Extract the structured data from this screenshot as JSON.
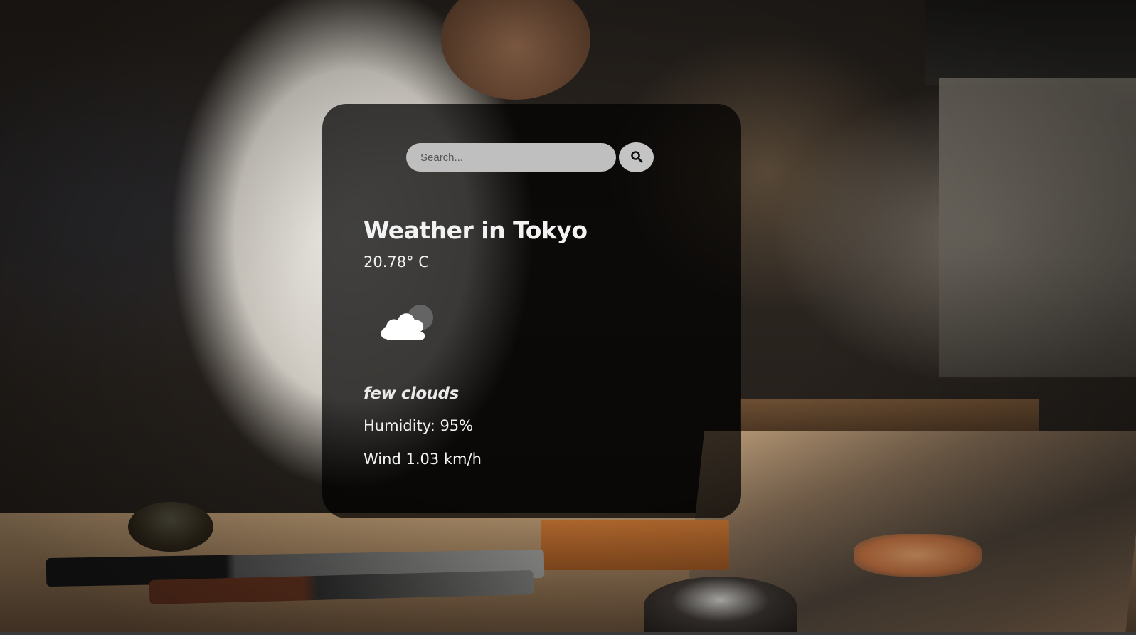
{
  "search": {
    "placeholder": "Search...",
    "value": "",
    "button_icon": "search-icon"
  },
  "weather": {
    "title": "Weather in Tokyo",
    "temperature": "20.78° C",
    "icon": "cloud-icon",
    "description": "few clouds",
    "humidity": "Humidity: 95%",
    "wind": "Wind 1.03 km/h"
  },
  "colors": {
    "card_background": "rgba(0,0,0,0.72)",
    "search_field": "#bfbfbf",
    "search_button": "#c4c4c4",
    "text": "#f2f2f2"
  }
}
